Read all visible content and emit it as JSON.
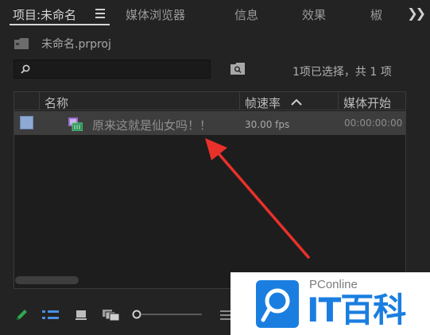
{
  "tabs": [
    {
      "label": "项目:未命名",
      "active": true
    },
    {
      "label": "媒体浏览器",
      "active": false
    },
    {
      "label": "信息",
      "active": false
    },
    {
      "label": "效果",
      "active": false
    },
    {
      "label": "椒",
      "active": false
    }
  ],
  "project": {
    "file_name": "未命名.prproj"
  },
  "search": {
    "value": "",
    "placeholder": ""
  },
  "selection_status": "1项已选择，共 1 项",
  "table": {
    "headers": {
      "name": "名称",
      "frame_rate": "帧速率",
      "media_start": "媒体开始"
    },
    "sort": {
      "column": "frame_rate",
      "direction": "ascending"
    },
    "rows": [
      {
        "label_color": "#8ea9d6",
        "name": "原来这就是仙女吗！！",
        "frame_rate": "30.00 fps",
        "media_start": "00:00:00:00"
      }
    ]
  },
  "toolbar": {
    "icons": [
      "pencil-icon",
      "list-view-icon",
      "icon-view-icon",
      "freeform-view-icon",
      "zoom-slider",
      "more-icon"
    ],
    "zoom_level": 0.0
  },
  "watermark": {
    "brand": "PConline",
    "name": "IT百科",
    "color": "#1a7ee0"
  },
  "colors": {
    "panel_bg": "#232323",
    "selected_row": "#3d3d3d",
    "arrow": "#e8312a"
  }
}
